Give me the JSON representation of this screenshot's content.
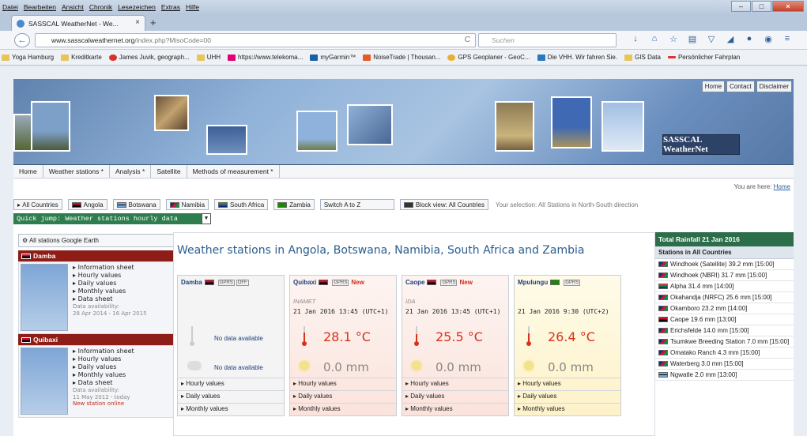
{
  "browser": {
    "menu": [
      "Datei",
      "Bearbeiten",
      "Ansicht",
      "Chronik",
      "Lesezeichen",
      "Extras",
      "Hilfe"
    ],
    "tab_title": "SASSCAL WeatherNet - We...",
    "url_domain": "www.sasscalweathernet.org",
    "url_path": "/index.php?MisoCode=00",
    "search_placeholder": "Suchen",
    "bookmarks": [
      "Yoga Hamburg",
      "Kreditkarte",
      "James Juvik, geograph...",
      "UHH",
      "https://www.telekoma...",
      "myGarmin™",
      "NoiseTrade | Thousan...",
      "GPS Geoplaner - GeoC...",
      "Die VHH. Wir fahren Sie.",
      "GIS Data",
      "Persönlicher Fahrplan"
    ]
  },
  "site": {
    "top_links": [
      "Home",
      "Contact",
      "Disclaimer"
    ],
    "brand": "SASSCAL WeatherNet",
    "nav": [
      "Home",
      "Weather stations *",
      "Analysis *",
      "Satellite",
      "Methods of measurement *"
    ],
    "breadcrumb_prefix": "You are here:",
    "breadcrumb_link": "Home"
  },
  "filters": {
    "buttons": [
      "All Countries",
      "Angola",
      "Botswana",
      "Namibia",
      "South Africa",
      "Zambia",
      "Switch A to Z",
      "Block view: All Countries"
    ],
    "selection": "Your selection: All Stations in North-South direction",
    "quick_jump": "Quick jump: Weather stations hourly data"
  },
  "sidebar": {
    "google_earth": "All stations Google Earth",
    "stations": [
      {
        "name": "Damba",
        "links": [
          "Information sheet",
          "Hourly values",
          "Daily values",
          "Monthly values",
          "Data sheet"
        ],
        "avail_label": "Data availability:",
        "avail_range": "28 Apr 2014 - 16 Apr 2015",
        "note": ""
      },
      {
        "name": "Quibaxi",
        "links": [
          "Information sheet",
          "Hourly values",
          "Daily values",
          "Monthly values",
          "Data sheet"
        ],
        "avail_label": "Data availability:",
        "avail_range": "11 May 2012 - today",
        "note": "New station online"
      }
    ]
  },
  "main": {
    "title": "Weather stations in Angola, Botswana, Namibia, South Africa and Zambia",
    "cards": [
      {
        "name": "Damba",
        "tags": [
          "GPRS",
          "OFF"
        ],
        "new": "",
        "source": "",
        "datetime": "",
        "temp": "No data available",
        "rain": "No data available"
      },
      {
        "name": "Quibaxi",
        "tags": [
          "GPRS"
        ],
        "new": "New",
        "source": "INAMET",
        "datetime": "21 Jan 2016 13:45 (UTC+1)",
        "temp": "28.1 °C",
        "rain": "0.0 mm"
      },
      {
        "name": "Caope",
        "tags": [
          "GPRS"
        ],
        "new": "New",
        "source": "IDA",
        "datetime": "21 Jan 2016 13:45 (UTC+1)",
        "temp": "25.5 °C",
        "rain": "0.0 mm"
      },
      {
        "name": "Mpulungu",
        "tags": [
          "GPRS"
        ],
        "new": "",
        "source": "",
        "datetime": "21 Jan 2016 9:30 (UTC+2)",
        "temp": "26.4 °C",
        "rain": "0.0 mm"
      }
    ],
    "card_links": [
      "Hourly values",
      "Daily values",
      "Monthly values"
    ]
  },
  "rainfall": {
    "title": "Total Rainfall 21 Jan 2016",
    "subtitle": "Stations in All Countries",
    "rows": [
      "Windhoek (Satellite) 39.2 mm [15:00]",
      "Windhoek (NBRI) 31.7 mm [15:00]",
      "Alpha 31.4 mm [14:00]",
      "Okahandja (NRFC) 25.6 mm [15:00]",
      "Okamboro 23.2 mm [14:00]",
      "Caope 19.6 mm [13:00]",
      "Erichsfelde 14.0 mm [15:00]",
      "Tsumkwe Breeding Station 7.0 mm [15:00]",
      "Omatako Ranch 4.3 mm [15:00]",
      "Waterberg 3.0 mm [15:00]",
      "Ngwatle 2.0 mm [13:00]"
    ]
  },
  "colors": {
    "accent_green": "#2e7d4f",
    "station_red": "#8e1d17",
    "temp_red": "#d9321c",
    "link_blue": "#1c3f7a"
  }
}
